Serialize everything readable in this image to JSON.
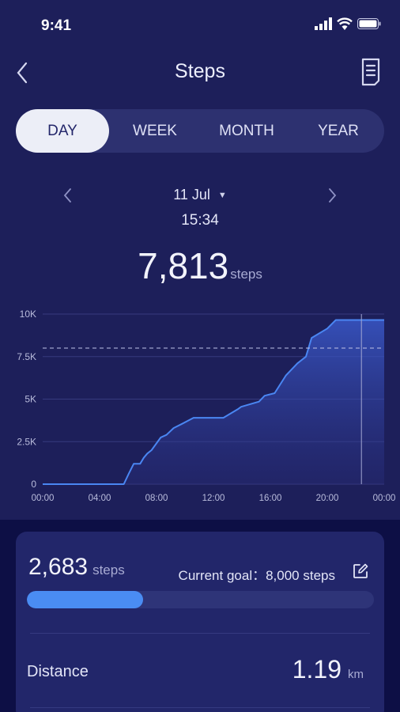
{
  "status": {
    "time": "9:41"
  },
  "header": {
    "title": "Steps"
  },
  "tabs": [
    "DAY",
    "WEEK",
    "MONTH",
    "YEAR"
  ],
  "active_tab": "DAY",
  "date": {
    "label": "11 Jul",
    "time": "15:34"
  },
  "total": {
    "value": "7,813",
    "unit": "steps"
  },
  "chart_data": {
    "type": "area",
    "x_unit": "hours",
    "x": [
      0,
      5.3,
      5.55,
      5.7,
      6.05,
      6.4,
      6.6,
      6.85,
      7.1,
      7.35,
      7.65,
      8.3,
      8.7,
      9.2,
      9.8,
      10.6,
      11.4,
      12.7,
      13.0,
      13.7,
      13.95,
      15.2,
      15.6,
      16.3,
      17.1,
      17.9,
      18.5,
      18.9,
      20.0,
      20.6,
      22.4,
      24
    ],
    "y": [
      0,
      0,
      0,
      0,
      620,
      1200,
      1200,
      1200,
      1550,
      1800,
      2000,
      2750,
      2900,
      3300,
      3550,
      3900,
      3900,
      3900,
      4050,
      4400,
      4550,
      4850,
      5200,
      5350,
      6400,
      7100,
      7500,
      8600,
      9150,
      9650,
      9650,
      9650
    ],
    "xticks": [
      "00:00",
      "04:00",
      "08:00",
      "12:00",
      "16:00",
      "20:00",
      "00:00"
    ],
    "yticks": [
      "0",
      "2.5K",
      "5K",
      "7.5K",
      "10K"
    ],
    "ylim": [
      0,
      10000
    ],
    "goal_line": 8000,
    "cursor_x": 22.4,
    "grid": true
  },
  "today": {
    "value": "2,683",
    "unit": "steps",
    "goal_label": "Current goal：8,000 steps",
    "progress": 0.335
  },
  "distance": {
    "label": "Distance",
    "value": "1.19",
    "unit": "km"
  },
  "colors": {
    "accent": "#4a8cf3",
    "background": "#1d1f5a",
    "card": "#22266a"
  }
}
